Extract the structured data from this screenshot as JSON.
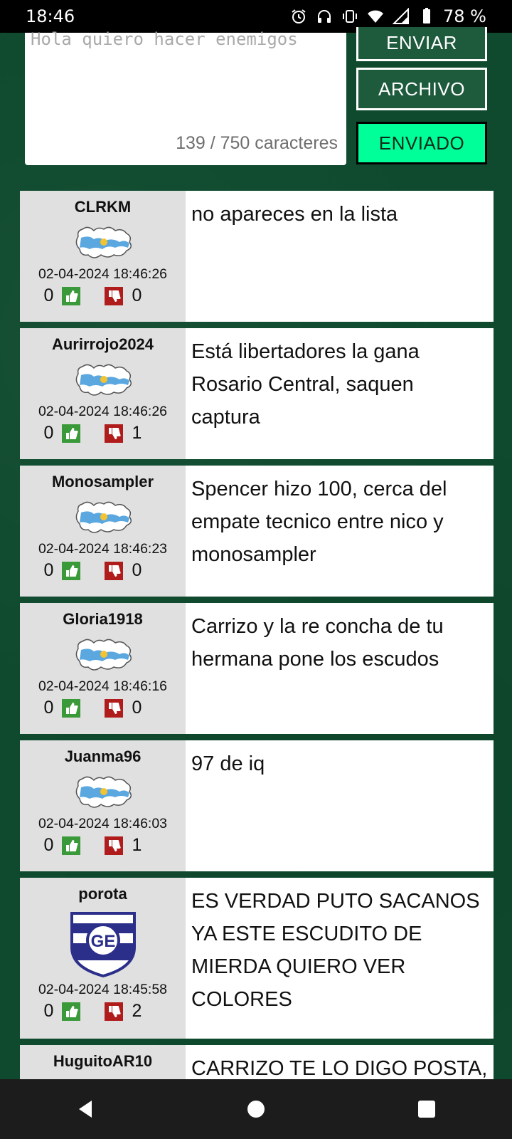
{
  "status": {
    "time": "18:46",
    "battery": "78 %",
    "icons": [
      "alarm-icon",
      "headphones-icon",
      "vibrate-icon",
      "wifi-icon",
      "signal-icon",
      "battery-icon"
    ]
  },
  "composer": {
    "text": "Hola quiero hacer enemigos",
    "counter": "139 / 750 caracteres",
    "send_label": "ENVIAR",
    "file_label": "ARCHIVO",
    "sent_label": "ENVIADO"
  },
  "posts": [
    {
      "user": "CLRKM",
      "time": "02-04-2024 18:46:26",
      "up": "0",
      "down": "0",
      "message": "no apareces en la lista",
      "avatar": "falklands-flag-map"
    },
    {
      "user": "Aurirrojo2024",
      "time": "02-04-2024 18:46:26",
      "up": "0",
      "down": "1",
      "message": "Está libertadores la gana Rosario Central, saquen captura",
      "avatar": "falklands-flag-map"
    },
    {
      "user": "Monosampler",
      "time": "02-04-2024 18:46:23",
      "up": "0",
      "down": "0",
      "message": "Spencer hizo 100, cerca del empate tecnico entre nico y monosampler",
      "avatar": "falklands-flag-map"
    },
    {
      "user": "Gloria1918",
      "time": "02-04-2024 18:46:16",
      "up": "0",
      "down": "0",
      "message": "Carrizo y la re concha de tu hermana pone los escudos",
      "avatar": "falklands-flag-map"
    },
    {
      "user": "Juanma96",
      "time": "02-04-2024 18:46:03",
      "up": "0",
      "down": "1",
      "message": "97 de iq",
      "avatar": "falklands-flag-map"
    },
    {
      "user": "porota",
      "time": "02-04-2024 18:45:58",
      "up": "0",
      "down": "2",
      "message": "ES VERDAD PUTO SACANOS YA ESTE ESCUDITO DE MIERDA QUIERO VER COLORES",
      "avatar": "club-shield-GE"
    },
    {
      "user": "HuguitoAR10",
      "message": "CARRIZO TE LO DIGO POSTA,",
      "avatar": ""
    }
  ],
  "colors": {
    "background": "#0f4a2e",
    "button_bg": "#1e5a3c",
    "sent_bg": "#00ff99",
    "upvote": "#3a9a3a",
    "downvote": "#b01c1c"
  }
}
